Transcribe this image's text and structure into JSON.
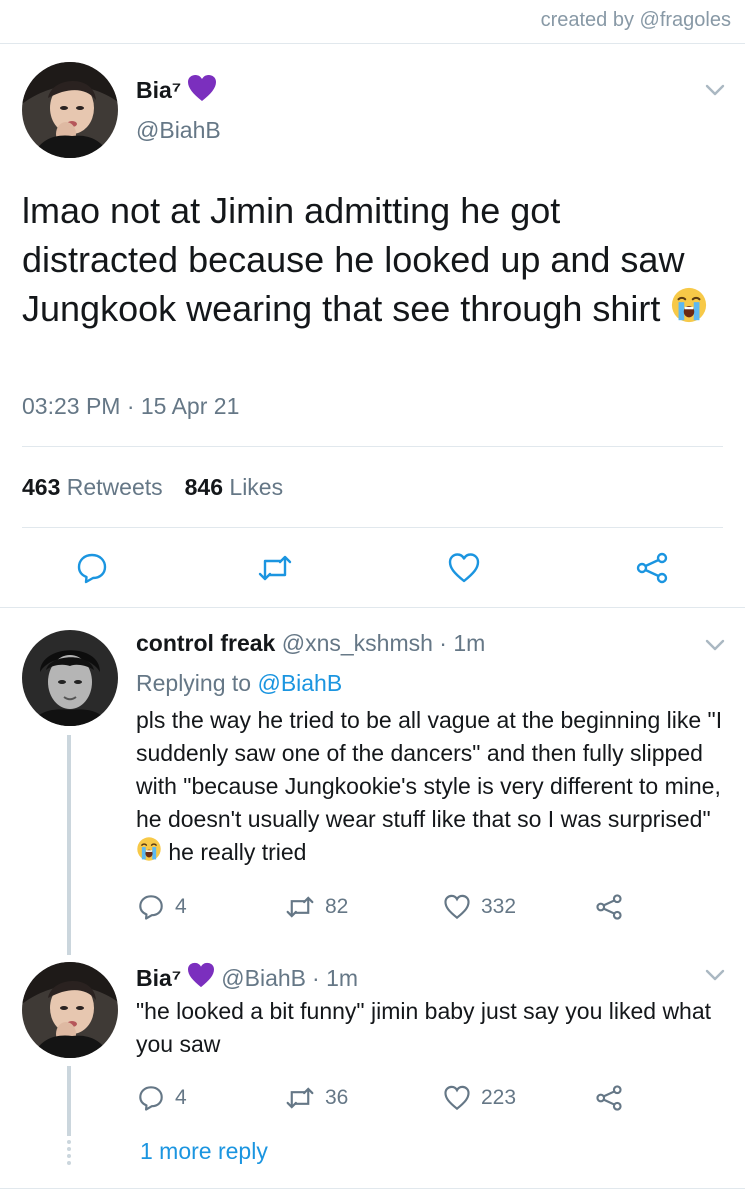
{
  "credit": "created by @fragoles",
  "main_tweet": {
    "name": "Bia⁷",
    "handle": "@BiahB",
    "text": "lmao not at Jimin admitting he got distracted because he looked up and saw Jungkook wearing that see through shirt",
    "time": "03:23 PM · 15 Apr 21",
    "retweets_count": "463",
    "retweets_label": "Retweets",
    "likes_count": "846",
    "likes_label": "Likes"
  },
  "replies": [
    {
      "name": "control freak",
      "handle": "@xns_kshmsh",
      "time": "· 1m",
      "replying_prefix": "Replying to",
      "replying_to": "@BiahB",
      "text_before_emoji": "pls the way he tried to be all vague at the beginning like \"I suddenly saw one of the dancers\" and then fully slipped with \"because Jungkookie's style is very different to mine, he doesn't usually wear stuff like that so I was surprised\"",
      "text_after_emoji": "he really tried",
      "reply_count": "4",
      "retweet_count": "82",
      "like_count": "332"
    },
    {
      "name": "Bia⁷",
      "handle": "@BiahB",
      "time": "· 1m",
      "text": "\"he looked a bit funny\" jimin baby just say you liked what you saw",
      "reply_count": "4",
      "retweet_count": "36",
      "like_count": "223"
    }
  ],
  "more_replies": "1 more reply",
  "colors": {
    "link": "#1b95e0",
    "secondary_text": "#657786",
    "divider": "#e1e8ed",
    "heart_emoji": "#7b2fbe"
  },
  "icons": {
    "verified_like_emoji": "purple-heart-icon",
    "crying_emoji": "loudly-crying-face-icon"
  }
}
